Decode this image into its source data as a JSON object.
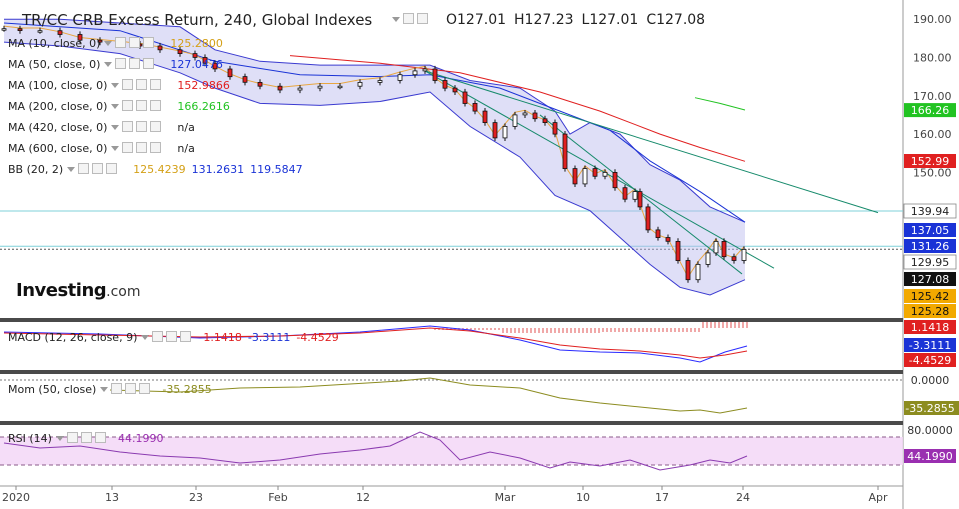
{
  "header": {
    "title": "TR/CC CRB Excess Return, 240, Global Indexes",
    "open": "O127.01",
    "high": "H127.23",
    "low": "L127.01",
    "close": "C127.08"
  },
  "indicators": [
    {
      "label": "MA (10, close, 0)",
      "value": "125.2800",
      "color": "#d4a017"
    },
    {
      "label": "MA (50, close, 0)",
      "value": "127.0476",
      "color": "#1a33d6"
    },
    {
      "label": "MA (100, close, 0)",
      "value": "152.9866",
      "color": "#e02020"
    },
    {
      "label": "MA (200, close, 0)",
      "value": "166.2616",
      "color": "#22c322"
    },
    {
      "label": "MA (420, close, 0)",
      "value": "n/a",
      "color": "#444444"
    },
    {
      "label": "MA (600, close, 0)",
      "value": "n/a",
      "color": "#444444"
    }
  ],
  "bb": {
    "label": "BB (20, 2)",
    "v1": "125.4239",
    "v2": "131.2631",
    "v3": "119.5847"
  },
  "logo": {
    "name": "Investing",
    "suffix": ".com"
  },
  "price_axis": {
    "ticks": [
      "190.00",
      "180.00",
      "170.00",
      "160.00",
      "150.00"
    ],
    "labels": [
      {
        "text": "166.26",
        "bg": "#22c322",
        "fg": "#ffffff"
      },
      {
        "text": "152.99",
        "bg": "#e02020",
        "fg": "#ffffff"
      },
      {
        "text": "139.94",
        "bg": "#ffffff",
        "fg": "#222222"
      },
      {
        "text": "137.05",
        "bg": "#1a33d6",
        "fg": "#ffffff"
      },
      {
        "text": "131.26",
        "bg": "#1a33d6",
        "fg": "#ffffff"
      },
      {
        "text": "129.95",
        "bg": "#ffffff",
        "fg": "#222222"
      },
      {
        "text": "127.08",
        "bg": "#111111",
        "fg": "#ffffff"
      },
      {
        "text": "125.42",
        "bg": "#f2a900",
        "fg": "#111111"
      },
      {
        "text": "125.28",
        "bg": "#f2a900",
        "fg": "#111111"
      }
    ]
  },
  "macd": {
    "label": "MACD (12, 26, close, 9)",
    "v1": "1.1418",
    "v2": "-3.3111",
    "v3": "-4.4529",
    "axis": [
      {
        "text": "1.1418",
        "bg": "#e02020",
        "fg": "#ffffff"
      },
      {
        "text": "-3.3111",
        "bg": "#1a33d6",
        "fg": "#ffffff"
      },
      {
        "text": "-4.4529",
        "bg": "#e02020",
        "fg": "#ffffff"
      }
    ]
  },
  "mom": {
    "label": "Mom (50, close)",
    "value": "-35.2855",
    "axis": [
      {
        "text": "0.0000",
        "bg": "#ffffff",
        "fg": "#333333"
      },
      {
        "text": "-35.2855",
        "bg": "#8c8c20",
        "fg": "#ffffff"
      }
    ]
  },
  "rsi": {
    "label": "RSI (14)",
    "value": "44.1990",
    "axis": [
      {
        "text": "80.0000",
        "bg": "#ffffff",
        "fg": "#333333"
      },
      {
        "text": "44.1990",
        "bg": "#9a2fb0",
        "fg": "#ffffff"
      }
    ]
  },
  "x_axis": [
    "2020",
    "13",
    "23",
    "Feb",
    "12",
    "Mar",
    "10",
    "17",
    "24",
    "Apr"
  ],
  "chart_data": {
    "type": "line",
    "title": "TR/CC CRB Excess Return, 240, Global Indexes",
    "xlabel": "",
    "ylabel": "",
    "ylim": [
      112,
      195
    ],
    "x": [
      "2020",
      "13",
      "23",
      "Feb",
      "12",
      "Mar",
      "10",
      "17",
      "24",
      "Apr"
    ],
    "series": [
      {
        "name": "TR/CC CRB Excess Return",
        "values": [
          187.5,
          183,
          177,
          172,
          173.5,
          173.5,
          146,
          137,
          125,
          null
        ]
      }
    ]
  }
}
